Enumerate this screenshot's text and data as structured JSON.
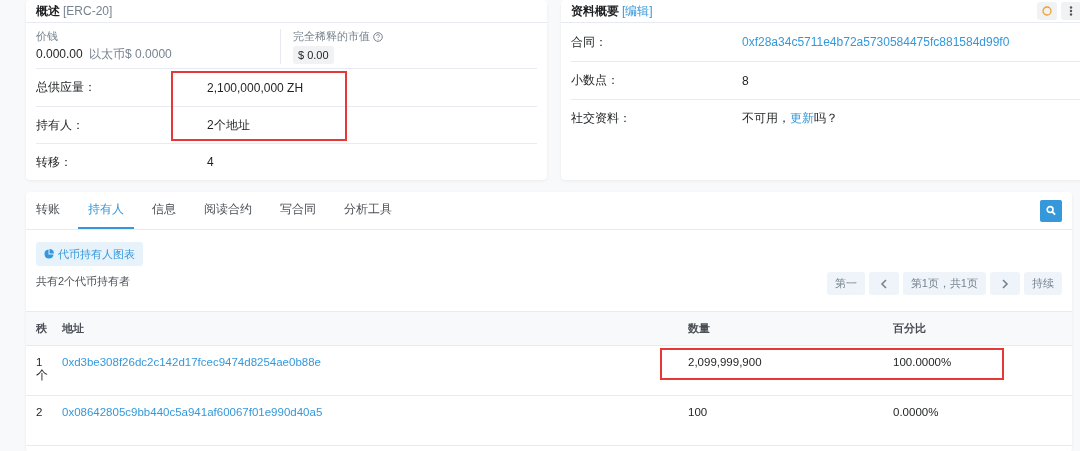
{
  "overview": {
    "title": "概述",
    "tag": "[ERC-20]",
    "price": {
      "label": "价钱",
      "value": "0.000.00",
      "unit": "以太币$ 0.0000"
    },
    "market_cap": {
      "label": "完全稀释的市值",
      "value": "$ 0.00"
    },
    "rows": [
      {
        "label": "总供应量：",
        "value": "2,100,000,000 ZH",
        "highlighted": true
      },
      {
        "label": "持有人：",
        "value": "2个地址",
        "highlighted": true
      },
      {
        "label": "转移：",
        "value": "4",
        "highlighted": false
      }
    ]
  },
  "profile": {
    "title": "资料概要",
    "edit": "[编辑]",
    "rows": [
      {
        "label": "合同：",
        "kind": "link",
        "value": "0xf28a34c5711e4b72a5730584475fc881584d99f0"
      },
      {
        "label": "小数点：",
        "kind": "text",
        "value": "8"
      },
      {
        "label": "社交资料：",
        "kind": "social",
        "before": "不可用，",
        "link": "更新",
        "after": "吗？"
      }
    ]
  },
  "tabs": [
    {
      "label": "转账",
      "selected": false
    },
    {
      "label": "持有人",
      "selected": true
    },
    {
      "label": "信息",
      "selected": false
    },
    {
      "label": "阅读合约",
      "selected": false
    },
    {
      "label": "写合同",
      "selected": false
    },
    {
      "label": "分析工具",
      "selected": false
    }
  ],
  "chart_button": "代币持有人图表",
  "holders_count": "共有2个代币持有者",
  "pagination": {
    "first": "第一",
    "page": "第1页，共1页",
    "last": "持续"
  },
  "table": {
    "columns": [
      "秩",
      "地址",
      "数量",
      "百分比"
    ],
    "rows": [
      {
        "rank": "1\n个",
        "address": "0xd3be308f26dc2c142d17fcec9474d8254ae0b88e",
        "quantity": "2,099,999,900",
        "percent": "100.0000%",
        "highlighted": true
      },
      {
        "rank": "2",
        "address": "0x08642805c9bb440c5a941af60067f01e990d40a5",
        "quantity": "100",
        "percent": "0.0000%",
        "highlighted": false
      }
    ]
  }
}
